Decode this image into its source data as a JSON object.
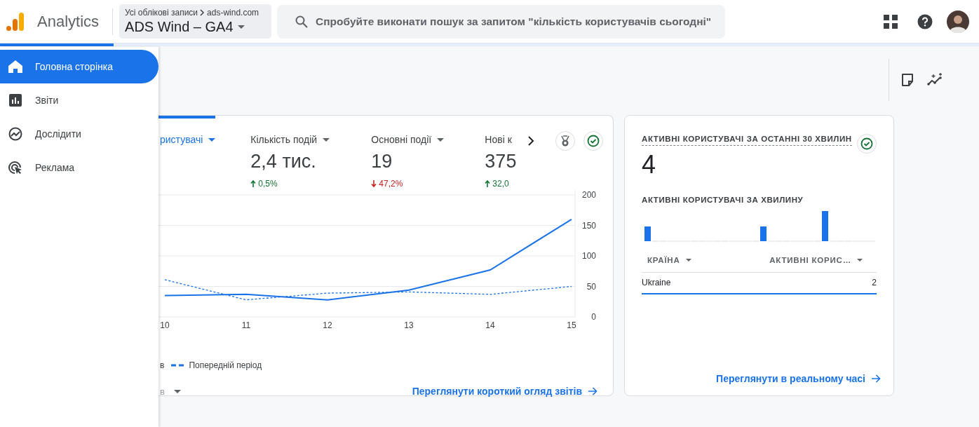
{
  "header": {
    "product": "Analytics",
    "account_path": {
      "parent": "Усі облікові записи",
      "child": "ads-wind.com"
    },
    "property": "ADS Wind – GA4",
    "search": {
      "placeholder": "Спробуйте виконати пошук за запитом \"кількість користувачів сьогодні\""
    }
  },
  "sidebar": {
    "items": [
      {
        "label": "Головна сторінка",
        "selected": true
      },
      {
        "label": "Звіти",
        "selected": false
      },
      {
        "label": "Дослідити",
        "selected": false
      },
      {
        "label": "Реклама",
        "selected": false
      }
    ]
  },
  "overview_card": {
    "metrics": [
      {
        "label": "ристувачі",
        "selected": true
      },
      {
        "label": "Кількість подій",
        "value": "2,4 тис.",
        "change": "0,5%",
        "increase": true,
        "selected": false
      },
      {
        "label": "Основні події",
        "value": "19",
        "change": "47,2%",
        "increase": false,
        "selected": false
      },
      {
        "label": "Нові к",
        "value": "375",
        "change": "32,0",
        "increase": true,
        "selected": false
      }
    ],
    "chart_data": {
      "type": "line",
      "categories": [
        "10",
        "11",
        "12",
        "13",
        "14",
        "15"
      ],
      "ylim": [
        0,
        200
      ],
      "yticks": [
        0,
        50,
        100,
        150,
        200
      ],
      "grid": true,
      "series": [
        {
          "name": "в",
          "color": "#1a73e8",
          "line_style": "solid",
          "values": [
            35,
            37,
            28,
            44,
            77,
            160
          ]
        },
        {
          "name": "Попередній період",
          "color": "#1a73e8",
          "line_style": "dashed",
          "values": [
            61,
            28,
            39,
            41,
            37,
            50
          ]
        }
      ]
    },
    "footer_dropdown": "в",
    "link": "Переглянути короткий огляд звітів"
  },
  "realtime_card": {
    "title": "АКТИВНІ КОРИСТУВАЧІ ЗА ОСТАННІ 30 ХВИЛИН",
    "value": "4",
    "subtitle": "АКТИВНІ КОРИСТУВАЧІ ЗА ХВИЛИНУ",
    "table": {
      "columns": [
        "КРАЇНА",
        "АКТИВНІ КОРИС…"
      ],
      "rows": [
        [
          "Ukraine",
          "2"
        ]
      ]
    },
    "link": "Переглянути в реальному часі"
  }
}
